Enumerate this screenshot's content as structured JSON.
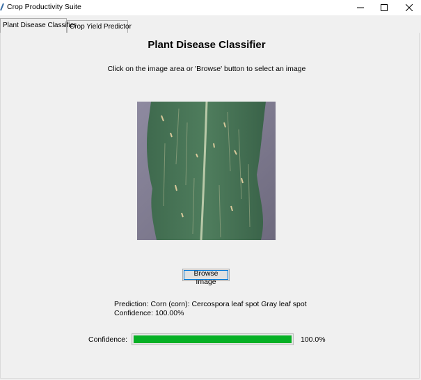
{
  "window": {
    "title": "Crop Productivity Suite",
    "controls": {
      "minimize": "minimize-icon",
      "maximize": "maximize-icon",
      "close": "close-icon"
    }
  },
  "tabs": [
    {
      "label": "Plant Disease Classifier",
      "active": true
    },
    {
      "label": "Crop Yield Predictor",
      "active": false
    }
  ],
  "main": {
    "title": "Plant Disease Classifier",
    "instruction": "Click on the image area or 'Browse' button to select an image",
    "browse_label": "Browse Image",
    "prediction_line": "Prediction: Corn (corn): Cercospora leaf spot Gray leaf spot",
    "confidence_line": "Confidence: 100.00%",
    "confidence_label": "Confidence:",
    "confidence_value": "100.0%",
    "confidence_fraction": 1.0
  },
  "colors": {
    "progress_fill": "#06b025",
    "background": "#f0f0f0"
  }
}
